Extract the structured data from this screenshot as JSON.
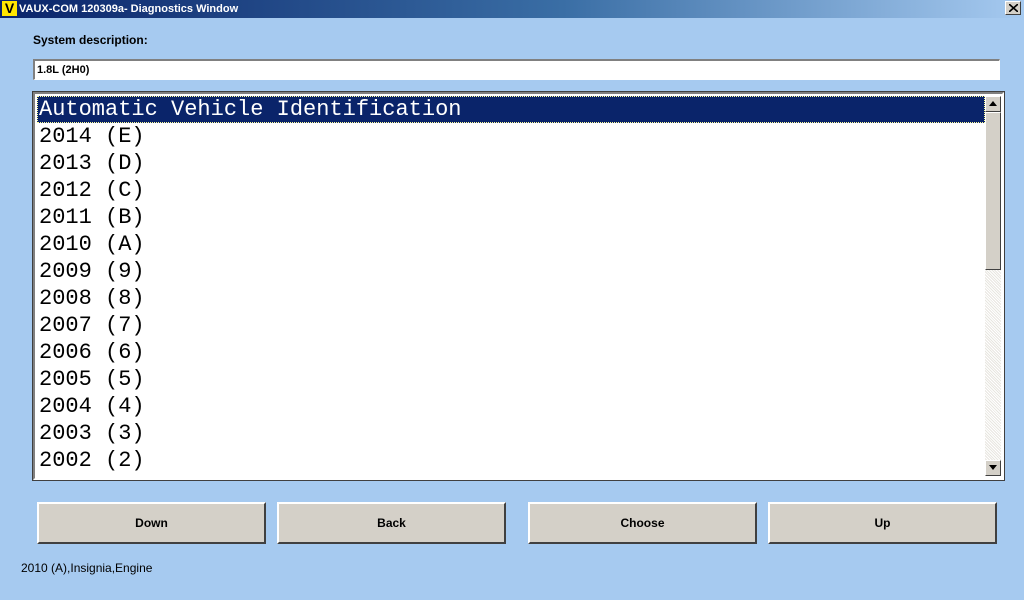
{
  "window": {
    "logo_letter": "V",
    "title": "VAUX-COM 120309a- Diagnostics Window"
  },
  "system": {
    "label": "System description:",
    "value": "1.8L (2H0)"
  },
  "list": {
    "items": [
      "Automatic Vehicle Identification",
      "2014 (E)",
      "2013 (D)",
      "2012 (C)",
      "2011 (B)",
      "2010 (A)",
      "2009 (9)",
      "2008 (8)",
      "2007 (7)",
      "2006 (6)",
      "2005 (5)",
      "2004 (4)",
      "2003 (3)",
      "2002 (2)"
    ],
    "selected_index": 0
  },
  "buttons": {
    "down": "Down",
    "back": "Back",
    "choose": "Choose",
    "up": "Up"
  },
  "status": "2010 (A),Insignia,Engine",
  "colors": {
    "background": "#a6caf0",
    "selection": "#0a246a",
    "button_face": "#d4d0c8",
    "logo": "#ffe600"
  },
  "icons": [
    "app-logo-icon",
    "close-icon",
    "scroll-up-arrow-icon",
    "scroll-down-arrow-icon"
  ]
}
